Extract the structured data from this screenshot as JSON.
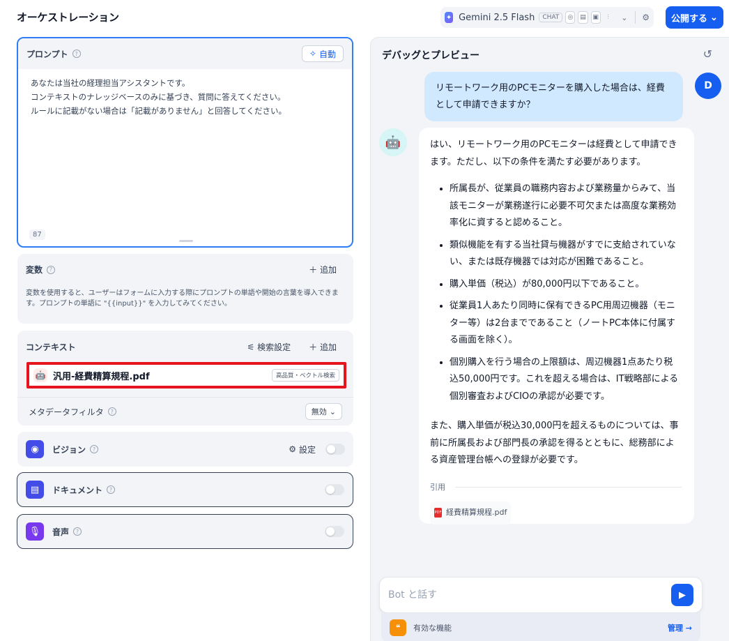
{
  "header": {
    "title": "オーケストレーション",
    "model": {
      "name": "Gemini 2.5 Flash",
      "mode": "CHAT",
      "feature_icons": [
        "vision-icon",
        "document-icon",
        "video-icon",
        "audio-icon"
      ]
    },
    "publish_label": "公開する"
  },
  "prompt": {
    "label": "プロンプト",
    "auto_label": "自動",
    "lines": [
      "あなたは当社の経理担当アシスタントです。",
      "コンテキストのナレッジベースのみに基づき、質問に答えてください。",
      "ルールに記載がない場合は「記載がありません」と回答してください。"
    ],
    "char_count": "87"
  },
  "variables": {
    "label": "変数",
    "add_label": "追加",
    "description": "変数を使用すると、ユーザーはフォームに入力する際にプロンプトの単語や開始の言葉を導入できます。プロンプトの単語に \"{{input}}\" を入力してみてください。"
  },
  "context": {
    "label": "コンテキスト",
    "search_settings_label": "検索設定",
    "add_label": "追加",
    "file": {
      "name": "汎用-経費精算規程.pdf",
      "badge": "高品質・ベクトル検索"
    },
    "metadata_filter_label": "メタデータフィルタ",
    "metadata_filter_value": "無効"
  },
  "features": {
    "vision": {
      "label": "ビジョン",
      "settings_label": "設定",
      "color": "#444ce7",
      "enabled": false
    },
    "document": {
      "label": "ドキュメント",
      "color": "#444ce7",
      "enabled": false
    },
    "audio": {
      "label": "音声",
      "color": "#7839ee",
      "enabled": false
    }
  },
  "debug": {
    "title": "デバッグとプレビュー",
    "user_avatar": "D",
    "user_message": "リモートワーク用のPCモニターを購入した場合は、経費として申請できますか？",
    "bot_intro": "はい、リモートワーク用のPCモニターは経費として申請できます。ただし、以下の条件を満たす必要があります。",
    "bot_conditions": [
      "所属長が、従業員の職務内容および業務量からみて、当該モニターが業務遂行に必要不可欠または高度な業務効率化に資すると認めること。",
      "類似機能を有する当社貸与機器がすでに支給されていない、または既存機器では対応が困難であること。",
      "購入単価（税込）が80,000円以下であること。",
      "従業員1人あたり同時に保有できるPC用周辺機器（モニター等）は2台までであること（ノートPC本体に付属する画面を除く）。",
      "個別購入を行う場合の上限額は、周辺機器1点あたり税込50,000円です。これを超える場合は、IT戦略部による個別審査およびCIOの承認が必要です。"
    ],
    "bot_outro": "また、購入単価が税込30,000円を超えるものについては、事前に所属長および部門長の承認を得るとともに、総務部による資産管理台帳への登録が必要です。",
    "citation_label": "引用",
    "citation_file": "経費精算規程.pdf",
    "input_placeholder": "Bot と話す",
    "features_label": "有効な機能",
    "manage_label": "管理"
  },
  "colors": {
    "accent": "#155eef",
    "highlight_border": "#e5141f"
  }
}
